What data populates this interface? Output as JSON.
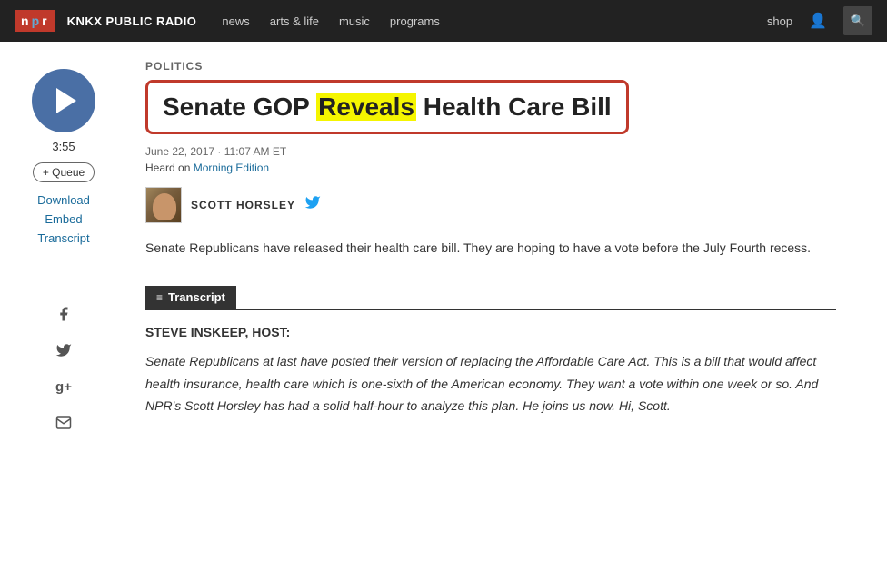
{
  "header": {
    "logo": "NPR",
    "logo_n": "n",
    "logo_p": "p",
    "logo_r": "r",
    "station": "KNKX PUBLIC RADIO",
    "nav": [
      {
        "label": "news",
        "id": "news"
      },
      {
        "label": "arts & life",
        "id": "arts-life"
      },
      {
        "label": "music",
        "id": "music"
      },
      {
        "label": "programs",
        "id": "programs"
      }
    ],
    "shop_label": "shop",
    "search_icon": "🔍"
  },
  "player": {
    "duration": "3:55",
    "queue_label": "+ Queue",
    "download_label": "Download",
    "embed_label": "Embed",
    "transcript_label": "Transcript"
  },
  "social": {
    "facebook_icon": "f",
    "twitter_icon": "t",
    "googleplus_icon": "g+",
    "email_icon": "✉"
  },
  "article": {
    "section": "POLITICS",
    "headline_part1": "Senate GOP ",
    "headline_highlight": "Reveals",
    "headline_part2": " Health Care Bill",
    "date": "June 22, 2017 · 11:07 AM ET",
    "heard_on_prefix": "Heard on ",
    "heard_on_show": "Morning Edition",
    "author_name": "SCOTT HORSLEY",
    "summary": "Senate Republicans have released their health care bill. They are hoping to have a vote before the July Fourth recess.",
    "transcript_section_label": "Transcript",
    "transcript_icon": "≡",
    "transcript_host": "STEVE INSKEEP, HOST:",
    "transcript_body": "Senate Republicans at last have posted their version of replacing the Affordable Care Act. This is a bill that would affect health insurance, health care which is one-sixth of the American economy. They want a vote within one week or so. And NPR's Scott Horsley has had a solid half-hour to analyze this plan. He joins us now. Hi, Scott."
  }
}
